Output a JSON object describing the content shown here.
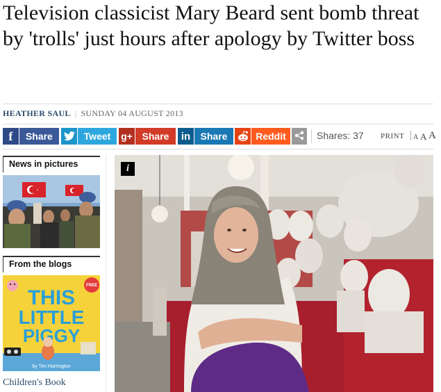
{
  "article": {
    "headline": "Television classicist Mary Beard sent bomb threat by 'trolls' just hours after apology by Twitter boss",
    "author": "HEATHER SAUL",
    "date": "SUNDAY 04 AUGUST 2013"
  },
  "share_bar": {
    "facebook": {
      "icon": "f",
      "label": "Share"
    },
    "twitter": {
      "icon": "twitter-bird-icon",
      "label": "Tweet"
    },
    "googleplus": {
      "icon": "g+",
      "label": "Share"
    },
    "linkedin": {
      "icon": "in",
      "label": "Share"
    },
    "reddit": {
      "icon": "reddit-alien-icon",
      "label": "Reddit"
    },
    "more": {
      "icon": "share-more-icon"
    },
    "shares_text": "Shares: 37",
    "print_label": "PRINT",
    "font_size_small": "A",
    "font_size_medium": "A",
    "font_size_large": "A"
  },
  "sidebar": {
    "news_in_pictures": {
      "title": "News in pictures"
    },
    "from_the_blogs": {
      "title": "From the blogs"
    },
    "blog_link": "Children's Book",
    "book_cover": {
      "line1": "THIS",
      "line2": "LITTLE",
      "line3": "PIGGY",
      "author": "by Tim Harrington",
      "badge": "FREE"
    }
  },
  "main_image": {
    "info_icon": "i"
  },
  "colors": {
    "facebook": "#3b5998",
    "twitter": "#2ea7df",
    "googleplus": "#d23b28",
    "linkedin": "#1a78b4",
    "reddit": "#ff5b1f",
    "author_link": "#2b4a6b"
  }
}
